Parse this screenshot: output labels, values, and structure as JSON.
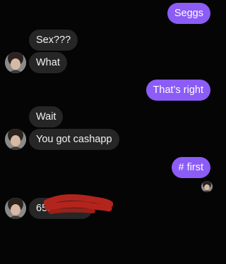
{
  "messages": [
    {
      "id": "m1",
      "direction": "sent",
      "text": "Seggs"
    },
    {
      "id": "m2",
      "direction": "received",
      "text": "Sex???"
    },
    {
      "id": "m3",
      "direction": "received",
      "text": "What"
    },
    {
      "id": "m4",
      "direction": "sent",
      "text": "That’s right"
    },
    {
      "id": "m5",
      "direction": "received",
      "text": "Wait"
    },
    {
      "id": "m6",
      "direction": "received",
      "text": "You got cashapp"
    },
    {
      "id": "m7",
      "direction": "sent",
      "text": "# first"
    },
    {
      "id": "m8",
      "direction": "received",
      "text": "651"
    }
  ],
  "colors": {
    "background": "#050505",
    "sent_bubble": "#8b5cf6",
    "received_bubble": "#262626",
    "redaction": "#b3241c"
  },
  "icons": {
    "avatar": "contact-avatar-icon",
    "read_receipt": "seen-avatar-icon"
  }
}
